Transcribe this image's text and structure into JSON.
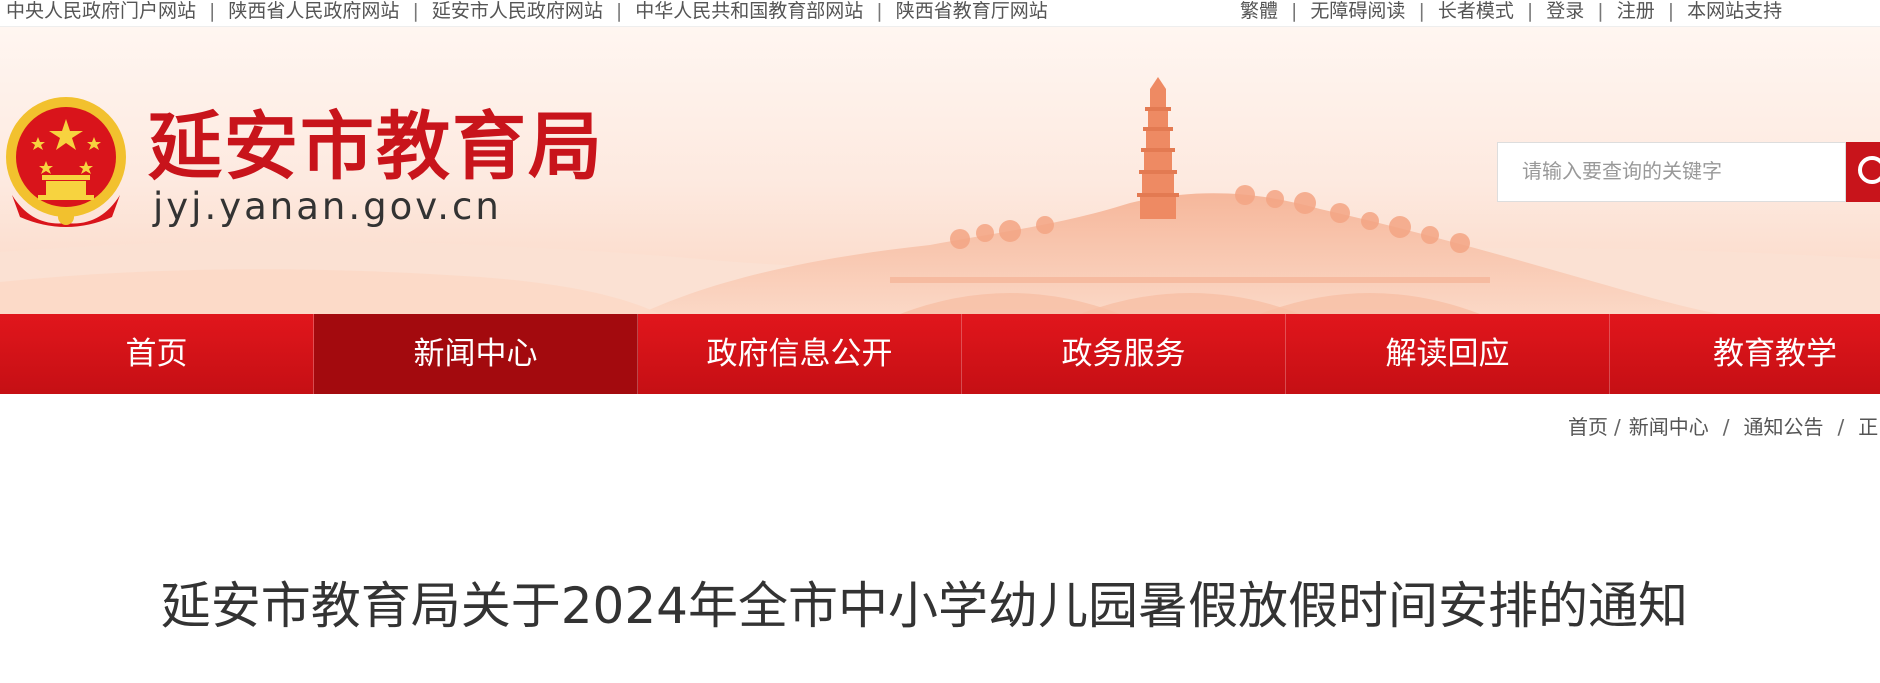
{
  "topbar": {
    "left_links": [
      {
        "label": "中央人民政府门户网站"
      },
      {
        "label": "陕西省人民政府网站"
      },
      {
        "label": "延安市人民政府网站"
      },
      {
        "label": "中华人民共和国教育部网站"
      },
      {
        "label": "陕西省教育厅网站"
      }
    ],
    "right_links": [
      {
        "label": "繁體"
      },
      {
        "label": "无障碍阅读"
      },
      {
        "label": "长者模式"
      },
      {
        "label": "登录"
      },
      {
        "label": "注册"
      },
      {
        "label": "本网站支持"
      }
    ],
    "separator": "|"
  },
  "header": {
    "site_name": "延安市教育局",
    "domain": "jyj.yanan.gov.cn",
    "brand_color": "#c8141b"
  },
  "search": {
    "placeholder": "请输入要查询的关键字",
    "value": "",
    "button_icon": "search-icon"
  },
  "nav": {
    "items": [
      {
        "label": "首页"
      },
      {
        "label": "新闻中心"
      },
      {
        "label": "政府信息公开"
      },
      {
        "label": "政务服务"
      },
      {
        "label": "解读回应"
      },
      {
        "label": "教育教学"
      }
    ],
    "active_label": "新闻中心",
    "bar_color": "#d7131a",
    "active_color": "#a30a0e"
  },
  "breadcrumb": {
    "items": [
      {
        "label": "首页"
      },
      {
        "label": "新闻中心"
      },
      {
        "label": "通知公告"
      },
      {
        "label": "正"
      }
    ],
    "separator": "/"
  },
  "article": {
    "title": "延安市教育局关于2024年全市中小学幼儿园暑假放假时间安排的通知"
  }
}
